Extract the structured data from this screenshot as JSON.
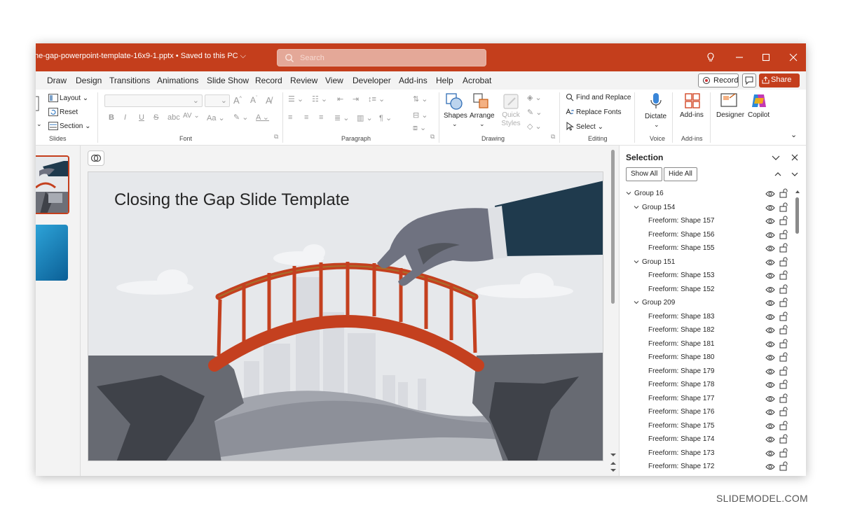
{
  "titlebar": {
    "doc_title": "he-gap-powerpoint-template-16x9-1.pptx • Saved to this PC ⌵",
    "search_placeholder": "Search",
    "accent": "#c43e1c"
  },
  "menu": {
    "items": [
      "Draw",
      "Design",
      "Transitions",
      "Animations",
      "Slide Show",
      "Record",
      "Review",
      "View",
      "Developer",
      "Add-ins",
      "Help",
      "Acrobat"
    ],
    "record_label": "Record",
    "share_label": "Share ⌄"
  },
  "ribbon": {
    "slides": {
      "layout": "Layout ⌄",
      "reset": "Reset",
      "section": "Section ⌄",
      "group": "Slides"
    },
    "font": {
      "group": "Font"
    },
    "paragraph": {
      "group": "Paragraph"
    },
    "drawing": {
      "shapes": "Shapes",
      "arrange": "Arrange",
      "quick_styles": "Quick Styles",
      "group": "Drawing"
    },
    "editing": {
      "find_replace": "Find and Replace",
      "replace_fonts": "Replace Fonts",
      "select": "Select ⌄",
      "group": "Editing"
    },
    "voice": {
      "dictate": "Dictate",
      "group": "Voice"
    },
    "addins": {
      "addins": "Add-ins",
      "group": "Add-ins"
    },
    "ai": {
      "designer": "Designer",
      "copilot": "Copilot"
    }
  },
  "slide": {
    "title": "Closing the Gap Slide Template",
    "bridge_color": "#c4401f"
  },
  "selection_pane": {
    "title": "Selection",
    "show_all": "Show All",
    "hide_all": "Hide All",
    "items": [
      {
        "label": "Group 16",
        "level": 0,
        "expanded": true
      },
      {
        "label": "Group 154",
        "level": 1,
        "expanded": true
      },
      {
        "label": "Freeform: Shape 157",
        "level": 2
      },
      {
        "label": "Freeform: Shape 156",
        "level": 2
      },
      {
        "label": "Freeform: Shape 155",
        "level": 2
      },
      {
        "label": "Group 151",
        "level": 1,
        "expanded": true
      },
      {
        "label": "Freeform: Shape 153",
        "level": 2
      },
      {
        "label": "Freeform: Shape 152",
        "level": 2
      },
      {
        "label": "Group 209",
        "level": 1,
        "expanded": true
      },
      {
        "label": "Freeform: Shape 183",
        "level": 2
      },
      {
        "label": "Freeform: Shape 182",
        "level": 2
      },
      {
        "label": "Freeform: Shape 181",
        "level": 2
      },
      {
        "label": "Freeform: Shape 180",
        "level": 2
      },
      {
        "label": "Freeform: Shape 179",
        "level": 2
      },
      {
        "label": "Freeform: Shape 178",
        "level": 2
      },
      {
        "label": "Freeform: Shape 177",
        "level": 2
      },
      {
        "label": "Freeform: Shape 176",
        "level": 2
      },
      {
        "label": "Freeform: Shape 175",
        "level": 2
      },
      {
        "label": "Freeform: Shape 174",
        "level": 2
      },
      {
        "label": "Freeform: Shape 173",
        "level": 2
      },
      {
        "label": "Freeform: Shape 172",
        "level": 2
      }
    ]
  },
  "watermark": "SLIDEMODEL.COM"
}
